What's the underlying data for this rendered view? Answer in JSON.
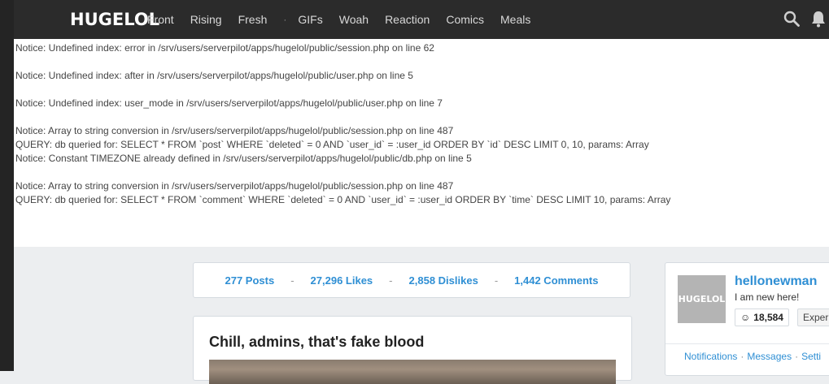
{
  "header": {
    "logo": "HUGELOL",
    "nav": [
      "Front",
      "Rising",
      "Fresh",
      "GIFs",
      "Woah",
      "Reaction",
      "Comics",
      "Meals"
    ],
    "separator": "·"
  },
  "notices": [
    "Notice: Undefined index: error in /srv/users/serverpilot/apps/hugelol/public/session.php on line 62",
    "Notice: Undefined index: after in /srv/users/serverpilot/apps/hugelol/public/user.php on line 5",
    "Notice: Undefined index: user_mode in /srv/users/serverpilot/apps/hugelol/public/user.php on line 7",
    "Notice: Array to string conversion in /srv/users/serverpilot/apps/hugelol/public/session.php on line 487",
    "QUERY: db queried for: SELECT * FROM `post` WHERE `deleted` = 0 AND `user_id` = :user_id ORDER BY `id` DESC LIMIT 0, 10, params: Array",
    "Notice: Constant TIMEZONE already defined in /srv/users/serverpilot/apps/hugelol/public/db.php on line 5",
    "Notice: Array to string conversion in /srv/users/serverpilot/apps/hugelol/public/session.php on line 487",
    "QUERY: db queried for: SELECT * FROM `comment` WHERE `deleted` = 0 AND `user_id` = :user_id ORDER BY `time` DESC LIMIT 10, params: Array"
  ],
  "stats": {
    "posts": "277 Posts",
    "likes": "27,296 Likes",
    "dislikes": "2,858 Dislikes",
    "comments": "1,442 Comments",
    "separator": "-"
  },
  "post": {
    "title": "Chill, admins, that's fake blood"
  },
  "profile": {
    "avatar_text": "HUGELOL",
    "username": "hellonewman",
    "bio": "I am new here!",
    "karma": "18,584",
    "badge": "Experi",
    "links": [
      "Notifications",
      "Messages",
      "Setti"
    ],
    "links_separator": "·"
  },
  "icons": {
    "search": "search-icon",
    "bell": "bell-icon",
    "smiley": "smiley-icon"
  }
}
